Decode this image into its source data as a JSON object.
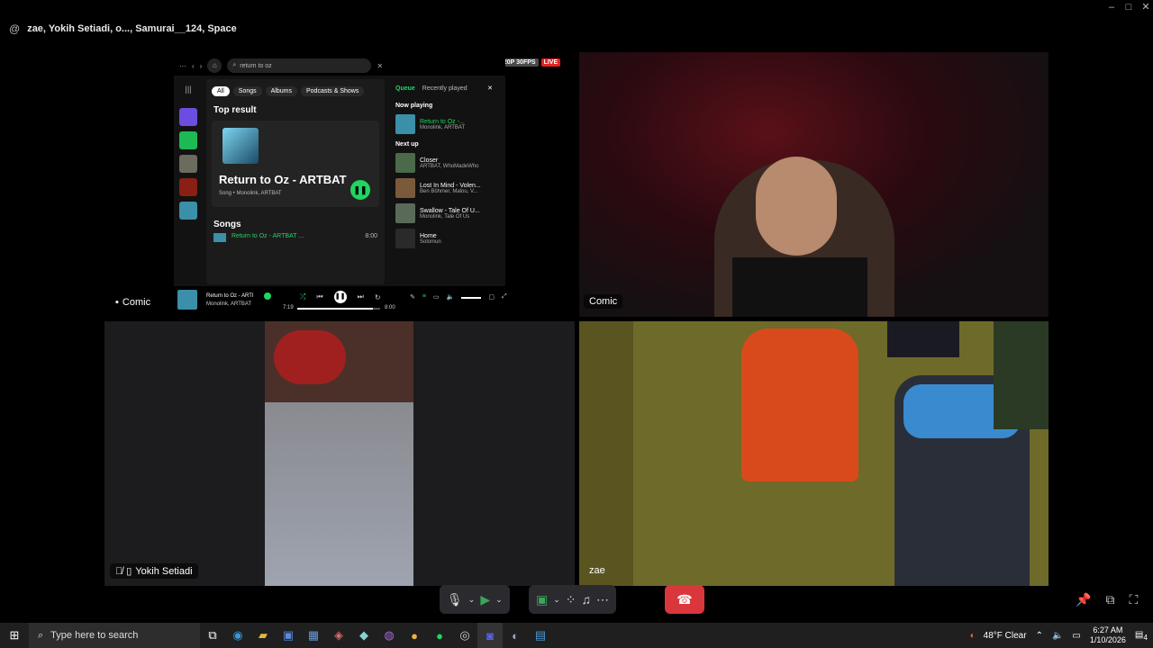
{
  "window": {
    "minimize": "–",
    "maximize": "□",
    "close": "✕"
  },
  "call": {
    "at_symbol": "@",
    "title": "zae, Yokih Setiadi, o..., Samurai__124, Space",
    "stream_badge": "720P 30FPS",
    "live_badge": "LIVE"
  },
  "tiles": {
    "screen_share_user": "Comic",
    "webcam_user": "Comic",
    "phone_user": "Yokih Setiadi",
    "room_user": "zae"
  },
  "spotify": {
    "search_value": "return to oz",
    "filters": [
      "All",
      "Songs",
      "Albums",
      "Podcasts & Shows"
    ],
    "top_result_heading": "Top result",
    "top_result_title": "Return to Oz - ARTBAT",
    "top_result_sub": "Song • Monolink, ARTBAT",
    "songs_heading": "Songs",
    "song_row_title": "Return to Oz - ARTBAT ...",
    "song_row_time": "8:00",
    "queue_tab": "Queue",
    "recent_tab": "Recently played",
    "now_playing_heading": "Now playing",
    "now_playing_title": "Return to Oz -...",
    "now_playing_artist": "Monolink, ARTBAT",
    "next_up_heading": "Next up",
    "queue": [
      {
        "title": "Closer",
        "artist": "ARTBAT, WhoMadeWho"
      },
      {
        "title": "Lost In Mind - Volen...",
        "artist": "Ben Böhmer, Malou, V..."
      },
      {
        "title": "Swallow - Tale Of U...",
        "artist": "Monolink, Tale Of Us"
      },
      {
        "title": "Home",
        "artist": "Solomun"
      }
    ],
    "player_title": "Return to Oz - ARTI",
    "player_artist": "Monolink, ARTBAT",
    "time_elapsed": "7:19",
    "time_total": "8:00",
    "progress_fraction": 0.91
  },
  "taskbar": {
    "search_placeholder": "Type here to search",
    "weather": "48°F  Clear",
    "time": "6:27 AM",
    "date": "1/10/2026",
    "notification_count": "4"
  },
  "colors": {
    "spotify_green": "#1ed760",
    "end_call": "#da373c",
    "live": "#e52222"
  }
}
